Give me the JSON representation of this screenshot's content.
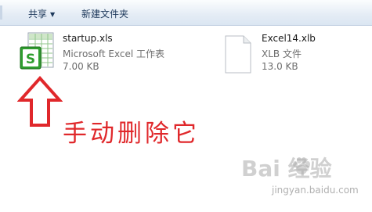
{
  "toolbar": {
    "share_label": "共享",
    "new_folder_label": "新建文件夹"
  },
  "files": [
    {
      "name": "startup.xls",
      "type": "Microsoft Excel 工作表",
      "size": "7.00 KB",
      "icon": "excel-file-icon"
    },
    {
      "name": "Excel14.xlb",
      "type": "XLB 文件",
      "size": "13.0 KB",
      "icon": "generic-file-icon"
    }
  ],
  "annotation": {
    "text": "手动删除它",
    "color": "#e0282b",
    "arrow": "up-arrow-icon"
  },
  "watermark": {
    "logo_text": "Bai 经验",
    "url": "jingyan.baidu.com"
  }
}
